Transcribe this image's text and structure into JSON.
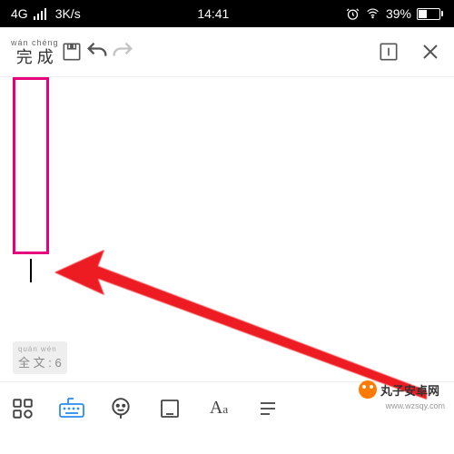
{
  "status": {
    "network": "4G",
    "speed": "3K/s",
    "time": "14:41",
    "battery_pct": "39%"
  },
  "toolbar": {
    "done_pinyin": "wán  chéng",
    "done_label": "完 成"
  },
  "footer_banner": {
    "pinyin": "quán wén",
    "label": "全 文 : 6"
  },
  "watermark": {
    "text": "丸子安卓网",
    "url": "www.wzsqy.com"
  },
  "icons": {
    "save": "save-icon",
    "undo": "undo-icon",
    "redo": "redo-icon",
    "info": "info-icon",
    "close": "close-icon",
    "grid": "grid-icon",
    "keyboard": "keyboard-icon",
    "face": "face-icon",
    "panel": "panel-icon",
    "font": "font-icon",
    "paragraph": "paragraph-icon"
  }
}
